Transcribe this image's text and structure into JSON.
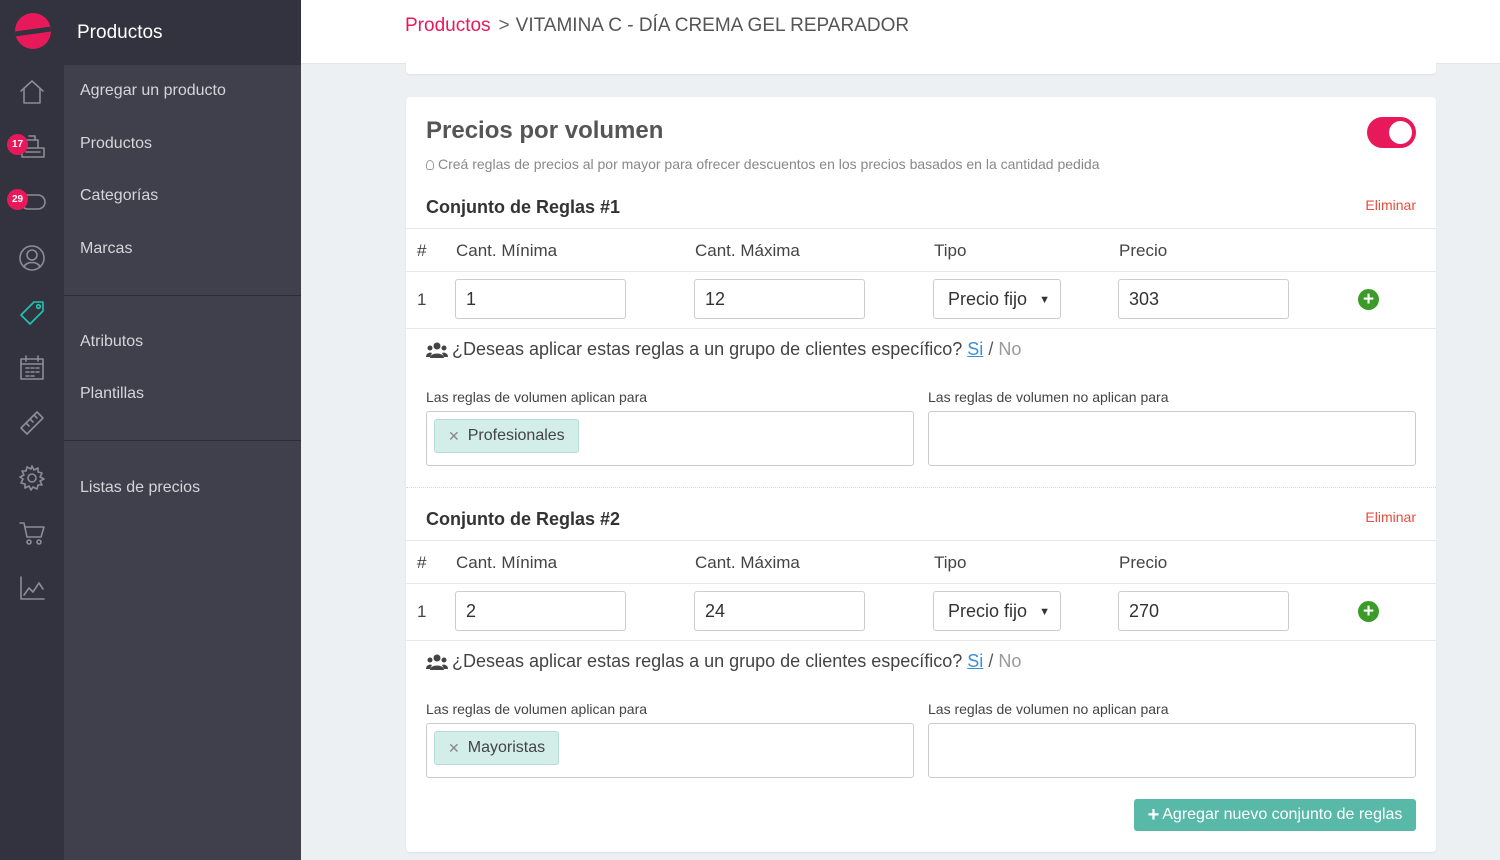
{
  "sidebar": {
    "section_title": "Productos",
    "badges": {
      "orders": "17",
      "messages": "29"
    },
    "items": [
      {
        "label": "Agregar un producto"
      },
      {
        "label": "Productos"
      },
      {
        "label": "Categorías"
      },
      {
        "label": "Marcas"
      },
      {
        "label": "Atributos"
      },
      {
        "label": "Plantillas"
      },
      {
        "label": "Listas de precios"
      }
    ],
    "rail_icons": [
      "home-icon",
      "register-icon",
      "toggle-icon",
      "user-icon",
      "tag-icon",
      "calendar-icon",
      "ruler-icon",
      "gear-icon",
      "cart-icon",
      "chart-icon"
    ]
  },
  "breadcrumb": {
    "root": "Productos",
    "separator": ">",
    "current": "VITAMINA C - DÍA CREMA GEL REPARADOR"
  },
  "panel": {
    "title": "Precios por volumen",
    "hint": "Creá reglas de precios al por mayor para ofrecer descuentos en los precios basados en la cantidad pedida",
    "enabled": true
  },
  "columns": {
    "num": "#",
    "min": "Cant. Mínima",
    "max": "Cant. Máxima",
    "type": "Tipo",
    "price": "Precio"
  },
  "question": {
    "text": "¿Deseas aplicar estas reglas a un grupo de clientes específico?",
    "yes": "Si",
    "slash": "/",
    "no": "No"
  },
  "applies_label": "Las reglas de volumen aplican para",
  "not_applies_label": "Las reglas de volumen no aplican para",
  "delete_label": "Eliminar",
  "rule_sets": [
    {
      "title": "Conjunto de Reglas #1",
      "row": {
        "num": "1",
        "min": "1",
        "max": "12",
        "type": "Precio fijo",
        "price": "303"
      },
      "applies": [
        "Profesionales"
      ],
      "not_applies": []
    },
    {
      "title": "Conjunto de Reglas #2",
      "row": {
        "num": "1",
        "min": "2",
        "max": "24",
        "type": "Precio fijo",
        "price": "270"
      },
      "applies": [
        "Mayoristas"
      ],
      "not_applies": []
    }
  ],
  "add_button": {
    "plus": "+",
    "label": "Agregar nuevo conjunto de reglas"
  },
  "colors": {
    "accent": "#e8195b",
    "teal": "#58b9a9",
    "sidebar": "#3f404c",
    "rail": "#32333e",
    "delete": "#e74c3c",
    "plus_green": "#3c9a28"
  }
}
